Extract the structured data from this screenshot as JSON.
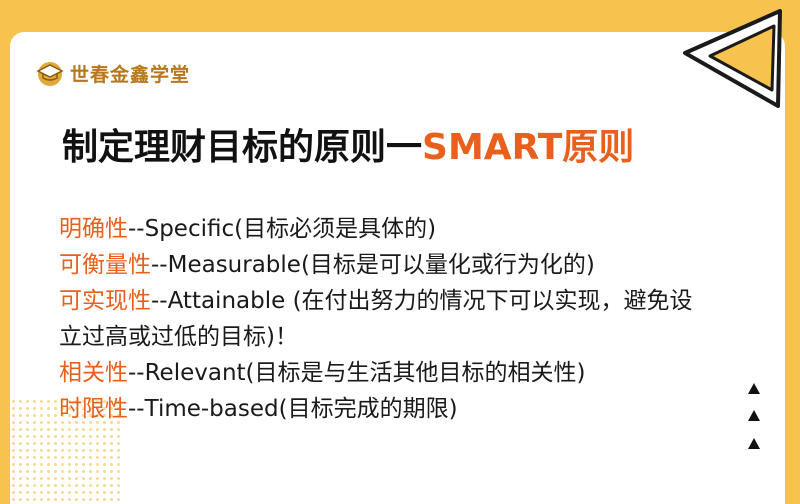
{
  "logo": {
    "text": "世春金鑫学堂",
    "icon": "graduation-cap-icon"
  },
  "title": {
    "main": "制定理财目标的原则一",
    "accent": "SMART原则"
  },
  "principles": [
    {
      "term": "明确性",
      "rest": "--Specific(目标必须是具体的)"
    },
    {
      "term": "可衡量性",
      "rest": "--Measurable(目标是可以量化或行为化的)"
    },
    {
      "term": "可实现性",
      "rest": "--Attainable (在付出努力的情况下可以实现，避免设"
    },
    {
      "term": "",
      "rest": "立过高或过低的目标)！"
    },
    {
      "term": "相关性",
      "rest": "--Relevant(目标是与生活其他目标的相关性)"
    },
    {
      "term": "时限性",
      "rest": "--Time-based(目标完成的期限)"
    }
  ],
  "colors": {
    "background": "#f7c24d",
    "accent": "#e8601c",
    "logo": "#b8771a"
  },
  "icons": [
    "graduation-cap-icon",
    "triangle-up-icon",
    "paper-plane-decoration"
  ]
}
